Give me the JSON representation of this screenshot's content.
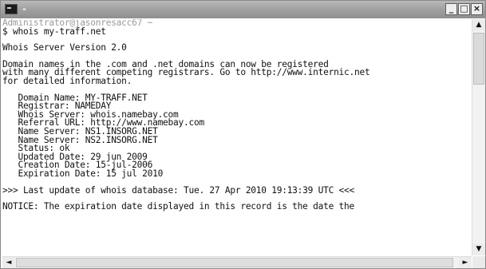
{
  "window": {
    "title": "-",
    "minimize_symbol": "_",
    "maximize_symbol": "□",
    "close_symbol": "×",
    "app_icon": "console-icon"
  },
  "console": {
    "prompt_user": "Administrator@jasonresacc67 ~",
    "lines": [
      "$ whois my-traff.net",
      "",
      "Whois Server Version 2.0",
      "",
      "Domain names in the .com and .net domains can now be registered",
      "with many different competing registrars. Go to http://www.internic.net",
      "for detailed information.",
      "",
      "   Domain Name: MY-TRAFF.NET",
      "   Registrar: NAMEDAY",
      "   Whois Server: whois.namebay.com",
      "   Referral URL: http://www.namebay.com",
      "   Name Server: NS1.INSORG.NET",
      "   Name Server: NS2.INSORG.NET",
      "   Status: ok",
      "   Updated Date: 29 jun 2009",
      "   Creation Date: 15-jul-2006",
      "   Expiration Date: 15 jul 2010",
      "",
      ">>> Last update of whois database: Tue. 27 Apr 2010 19:13:39 UTC <<<",
      "",
      "NOTICE: The expiration date displayed in this record is the date the"
    ]
  },
  "scrollbars": {
    "up_arrow": "▲",
    "down_arrow": "▼",
    "left_arrow": "◄",
    "right_arrow": "►"
  }
}
